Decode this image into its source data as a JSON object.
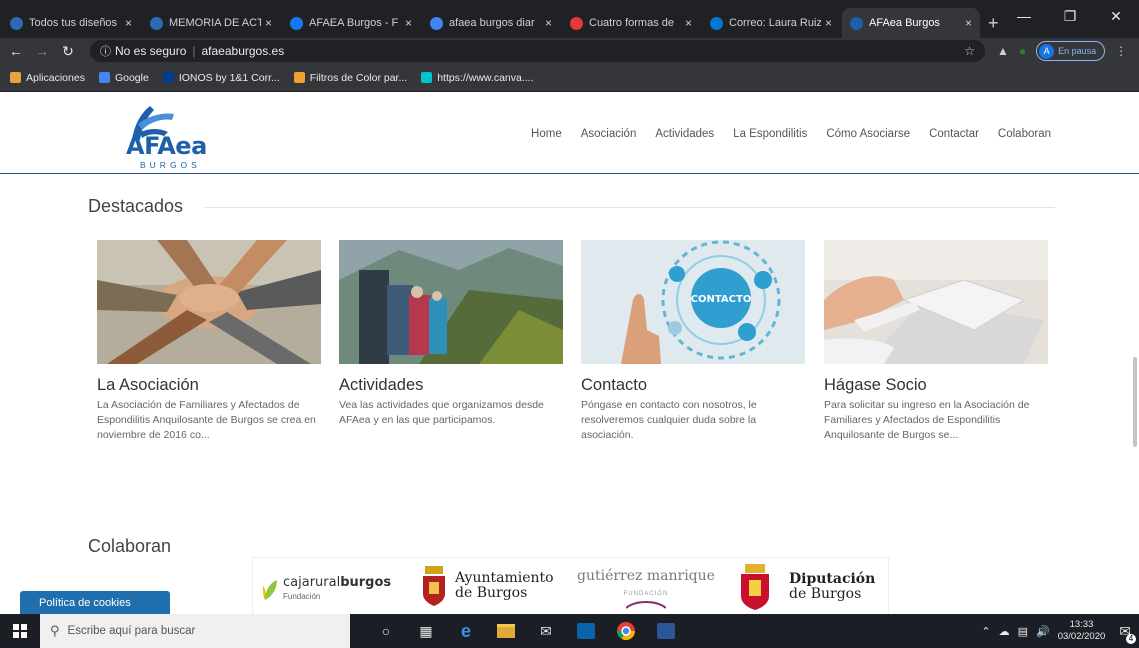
{
  "browser": {
    "tabs": [
      {
        "title": "Todos tus diseños",
        "color": "#2d6ab3",
        "active": false
      },
      {
        "title": "MEMORIA DE ACT",
        "color": "#2d6ab3",
        "active": false
      },
      {
        "title": "AFAEA Burgos - F",
        "color": "#1877f2",
        "active": false
      },
      {
        "title": "afaea burgos diar",
        "color": "#4285f4",
        "active": false
      },
      {
        "title": "Cuatro formas de",
        "color": "#e53935",
        "active": false
      },
      {
        "title": "Correo: Laura Ruiz",
        "color": "#0078d4",
        "active": false
      },
      {
        "title": "AFAea Burgos",
        "color": "#1d5fa8",
        "active": true
      }
    ],
    "new_tab": "+",
    "security_label": "No es seguro",
    "url": "afaeaburgos.es",
    "profile_initial": "A",
    "profile_status": "En pausa",
    "bookmarks": [
      {
        "label": "Aplicaciones",
        "color": "#e8a33d"
      },
      {
        "label": "Google",
        "color": "#4285f4"
      },
      {
        "label": "IONOS by 1&1 Corr...",
        "color": "#003d8f"
      },
      {
        "label": "Filtros de Color par...",
        "color": "#f0a030"
      },
      {
        "label": "https://www.canva....",
        "color": "#00c4cc"
      }
    ]
  },
  "site": {
    "logo_text": "AFAea",
    "logo_sub": "BURGOS",
    "nav": [
      "Home",
      "Asociación",
      "Actividades",
      "La Espondilitis",
      "Cómo Asociarse",
      "Contactar",
      "Colaboran"
    ],
    "featured_title": "Destacados",
    "cards": [
      {
        "title": "La Asociación",
        "text": "La Asociación de Familiares y Afectados de Espondilitis Anquilosante de Burgos se crea en noviembre de 2016 co..."
      },
      {
        "title": "Actividades",
        "text": "Vea las actividades que organizamos desde AFAea y en las que participamos."
      },
      {
        "title": "Contacto",
        "text": "Póngase en contacto con nosotros, le resolveremos cualquier duda sobre la asociación."
      },
      {
        "title": "Hágase Socio",
        "text": "Para solicitar su ingreso en la Asociación de Familiares y Afectados de Espondilitis Anquilosante de Burgos se..."
      }
    ],
    "contact_image_label": "CONTACTO",
    "sponsors_title": "Colaboran",
    "sponsors": {
      "caja_prefix": "cajarural",
      "caja_bold": "burgos",
      "caja_sub": "Fundación",
      "ayto_line1": "Ayuntamiento",
      "ayto_line2": "de Burgos",
      "gm_text": "gutiérrez manrique",
      "gm_sub": "FUNDACIÓN",
      "dip_line1": "Diputación",
      "dip_line2": "de Burgos"
    },
    "cookie_label": "Política de cookies"
  },
  "taskbar": {
    "search_placeholder": "Escribe aquí para buscar",
    "time": "13:33",
    "date": "03/02/2020",
    "notif_count": "4"
  }
}
